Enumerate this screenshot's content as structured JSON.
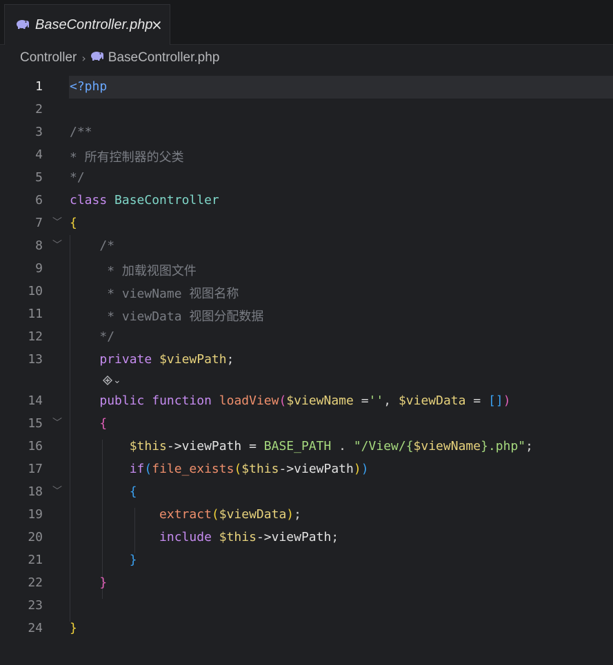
{
  "tab": {
    "label": "BaseController.php",
    "close": "×"
  },
  "breadcrumb": {
    "folder": "Controller",
    "file": "BaseController.php"
  },
  "lines": [
    {
      "n": "1"
    },
    {
      "n": "2"
    },
    {
      "n": "3"
    },
    {
      "n": "4"
    },
    {
      "n": "5"
    },
    {
      "n": "6"
    },
    {
      "n": "7"
    },
    {
      "n": "8"
    },
    {
      "n": "9"
    },
    {
      "n": "10"
    },
    {
      "n": "11"
    },
    {
      "n": "12"
    },
    {
      "n": "13"
    },
    {
      "n": "14"
    },
    {
      "n": "15"
    },
    {
      "n": "16"
    },
    {
      "n": "17"
    },
    {
      "n": "18"
    },
    {
      "n": "19"
    },
    {
      "n": "20"
    },
    {
      "n": "21"
    },
    {
      "n": "22"
    },
    {
      "n": "23"
    },
    {
      "n": "24"
    }
  ],
  "code": {
    "l1": "<?php",
    "l3": "/**",
    "l4": "* 所有控制器的父类",
    "l5": "*/",
    "l6_kw": "class",
    "l6_cls": "BaseController",
    "l7": "{",
    "l8": "/*",
    "l9": " * 加载视图文件",
    "l10": " * viewName 视图名称",
    "l11": " * viewData 视图分配数据",
    "l12": "*/",
    "l13_kw": "private",
    "l13_var": "$viewPath",
    "l13_semi": ";",
    "inlay_chevron": "⌄",
    "l14_kw1": "public",
    "l14_kw2": "function",
    "l14_fn": "loadView",
    "l14_p1": "(",
    "l14_v1": "$viewName",
    "l14_eq1": " =",
    "l14_s1": "''",
    "l14_c": ", ",
    "l14_v2": "$viewData",
    "l14_eq2": " = ",
    "l14_arr": "[]",
    "l14_p2": ")",
    "l15": "{",
    "l16_this": "$this",
    "l16_arrow": "->viewPath = ",
    "l16_const": "BASE_PATH",
    "l16_dot": " . ",
    "l16_s1": "\"/View/",
    "l16_b1": "{",
    "l16_v": "$viewName",
    "l16_b2": "}",
    "l16_s2": ".php\"",
    "l16_semi": ";",
    "l17_kw": "if",
    "l17_p1": "(",
    "l17_fn": "file_exists",
    "l17_p2": "(",
    "l17_this": "$this",
    "l17_prop": "->viewPath",
    "l17_p3": ")",
    "l17_p4": ")",
    "l18": "{",
    "l19_fn": "extract",
    "l19_p1": "(",
    "l19_v": "$viewData",
    "l19_p2": ")",
    "l19_semi": ";",
    "l20_kw": "include",
    "l20_this": "$this",
    "l20_prop": "->viewPath",
    "l20_semi": ";",
    "l21": "}",
    "l22": "}",
    "l24": "}"
  },
  "colors": {
    "background": "#1f2023",
    "keyword": "#c68cf0",
    "class": "#7fd6c8",
    "variable": "#e7d27c",
    "function": "#ef8f6c",
    "string": "#a6d97e",
    "comment": "#7a7d84"
  }
}
